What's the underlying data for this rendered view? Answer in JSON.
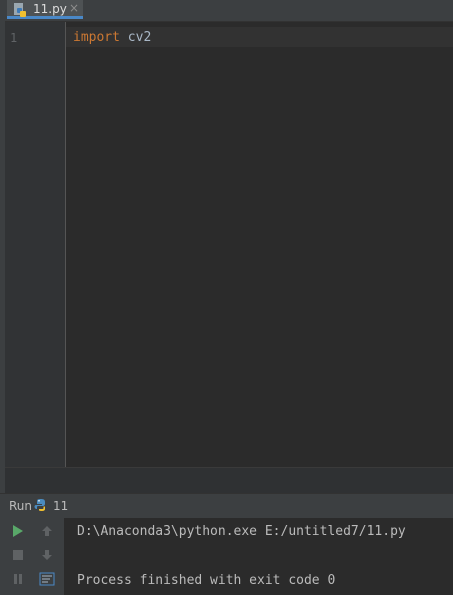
{
  "tab": {
    "filename": "11.py",
    "close_glyph": "×"
  },
  "editor": {
    "line_number": "1",
    "keyword": "import",
    "module": " cv2"
  },
  "run": {
    "label": "Run",
    "config_name": "11",
    "console_lines": [
      "D:\\Anaconda3\\python.exe E:/untitled7/11.py",
      "",
      "Process finished with exit code 0"
    ]
  },
  "colors": {
    "background": "#2b2b2b",
    "keyword": "#cc7832",
    "run_green": "#59a869",
    "tab_underline": "#4a88c7"
  },
  "icons": {
    "tab": "python-file-icon",
    "run_config": "python-icon",
    "tools": [
      "run-icon",
      "stop-icon",
      "pause-icon",
      "up-arrow-icon",
      "down-arrow-icon",
      "soft-wrap-icon"
    ]
  }
}
